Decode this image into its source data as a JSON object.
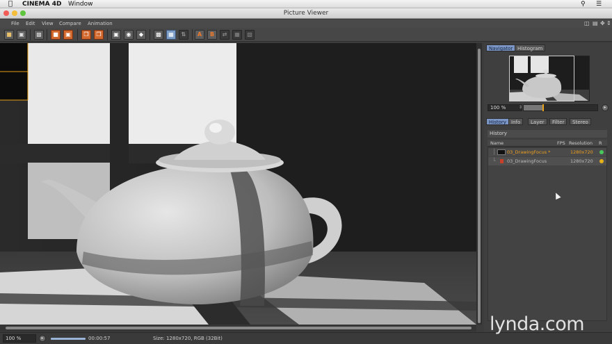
{
  "menubar": {
    "app_name": "CINEMA 4D",
    "window_menu": "Window"
  },
  "window": {
    "title": "Picture Viewer"
  },
  "app_menu": {
    "items": [
      "File",
      "Edit",
      "View",
      "Compare",
      "Animation"
    ]
  },
  "toolbar": {
    "button_a": "A",
    "button_b": "B"
  },
  "navigator": {
    "tabs": [
      "Navigator",
      "Histogram"
    ],
    "active_tab": "Navigator",
    "zoom": "100 %",
    "zoom_level_fraction": 0.25
  },
  "history_panel": {
    "tabs": [
      "History",
      "Info",
      "Layer",
      "Filter",
      "Stereo"
    ],
    "active_tab": "History",
    "title": "History",
    "columns": {
      "name": "Name",
      "fps": "FPS",
      "resolution": "Resolution",
      "r": "R"
    },
    "rows": [
      {
        "name": "03_DrawingFocus *",
        "resolution": "1280x720",
        "status_color": "#49c95b",
        "selected": true
      },
      {
        "name": "03_DrawingFocus",
        "resolution": "1280x720",
        "status_color": "#e6b21a",
        "selected": false
      }
    ]
  },
  "status_bar": {
    "zoom": "100 %",
    "timecode": "00:00:57",
    "info": "Size: 1280x720, RGB (32Bit)"
  },
  "watermark": "lynda.com",
  "colors": {
    "accent_orange": "#f0a020",
    "tab_active": "#7b95c4",
    "panel_bg": "#3f3f3f"
  }
}
